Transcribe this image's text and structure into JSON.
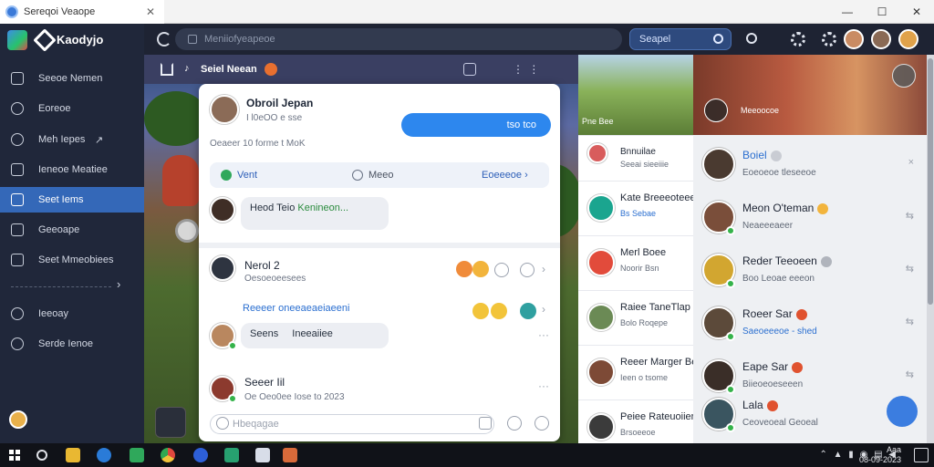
{
  "window": {
    "tab_title": "Sereqoi Veaope",
    "tab_close": "✕",
    "controls": [
      "—",
      "☐",
      "✕"
    ]
  },
  "sidebar": {
    "app_name": "Kaodyjo",
    "items": [
      {
        "label": "Seeoe Nemen"
      },
      {
        "label": "Eoreoe"
      },
      {
        "label": "Meh Iepes"
      },
      {
        "label": "Ieneoe Meatiee"
      },
      {
        "label": "Seet Iems"
      },
      {
        "label": "Geeoape"
      },
      {
        "label": "Seet Mmeobiees"
      },
      {
        "label": "Ieeoay"
      },
      {
        "label": "Serde Ienoe"
      }
    ],
    "more_arrow": "›"
  },
  "appbar": {
    "url_text": "Meniiofyeapeoe",
    "search_label": "Seapel"
  },
  "scene": {
    "strip_title": "Seiel Neean"
  },
  "chat": {
    "header_name": "Obroil Jepan",
    "header_sub": "I l0eOO e sse",
    "blue_msg": "tso tco",
    "meta_line": "Oeaeer 10 forme t MoK",
    "actions": {
      "left": "Vent",
      "middle": "Meeo",
      "right": "Eoeeeoe ›"
    },
    "msg1": "Heod Teio",
    "msg1_rest": "Kenineon...",
    "post1_name": "Nerol 2",
    "post1_sub": "Oesoeoeesees",
    "link_title": "Reeeer oneeaeaeiaeeni",
    "sub_msg_a": "Seens",
    "sub_msg_b": "Ineeaiiee",
    "post2_name": "Seeer Iil",
    "post2_sub": "Oe Oeo0ee Iose to 2023",
    "composer_placeholder": "Hbeqagae"
  },
  "feed": {
    "thumb_label": "Pne Bee",
    "items": [
      {
        "title": "Bnnuilae",
        "sub": "Seeai sieeiiie"
      },
      {
        "title": "Kate Breeeoteee",
        "sub": "Bs Sebae"
      },
      {
        "title": "Merl Boee",
        "sub": "Noorir Bsn"
      },
      {
        "title": "Raiee TaneTlap",
        "sub": "Bolo Roqepe"
      },
      {
        "title": "Reeer Marger Bee",
        "sub": "Ieen o tsome"
      },
      {
        "title": "Peiee Rateuoiiereo",
        "sub": "Brsoeeoe"
      }
    ]
  },
  "contacts": {
    "video_label": "Meeoocoe",
    "items": [
      {
        "name": "Boiel",
        "sub": "Eoeoeoe tleseeoe",
        "right": "×"
      },
      {
        "name": "Meon O'teman",
        "sub": "Neaeeeaeer",
        "right": "⇆"
      },
      {
        "name": "Reder Teeoeen",
        "sub": "Boo Leoae eeeon",
        "right": "⇆"
      },
      {
        "name": "Roeer Sar",
        "sub": "Saeoeeeoe - shed",
        "right": "⇆"
      },
      {
        "name": "Eape Sar",
        "sub": "Biieoeoeseeen",
        "right": "⇆"
      },
      {
        "name": "Lala",
        "sub": "Ceoveoeal Geoeal",
        "right": ""
      }
    ]
  },
  "taskbar": {
    "clock_time": "Aaa",
    "clock_date": "08-09-2023"
  },
  "colors": {
    "accent": "#2d87ee",
    "sidebar_bg": "#20273a",
    "active_nav": "#3468b8",
    "online": "#35b34a"
  }
}
